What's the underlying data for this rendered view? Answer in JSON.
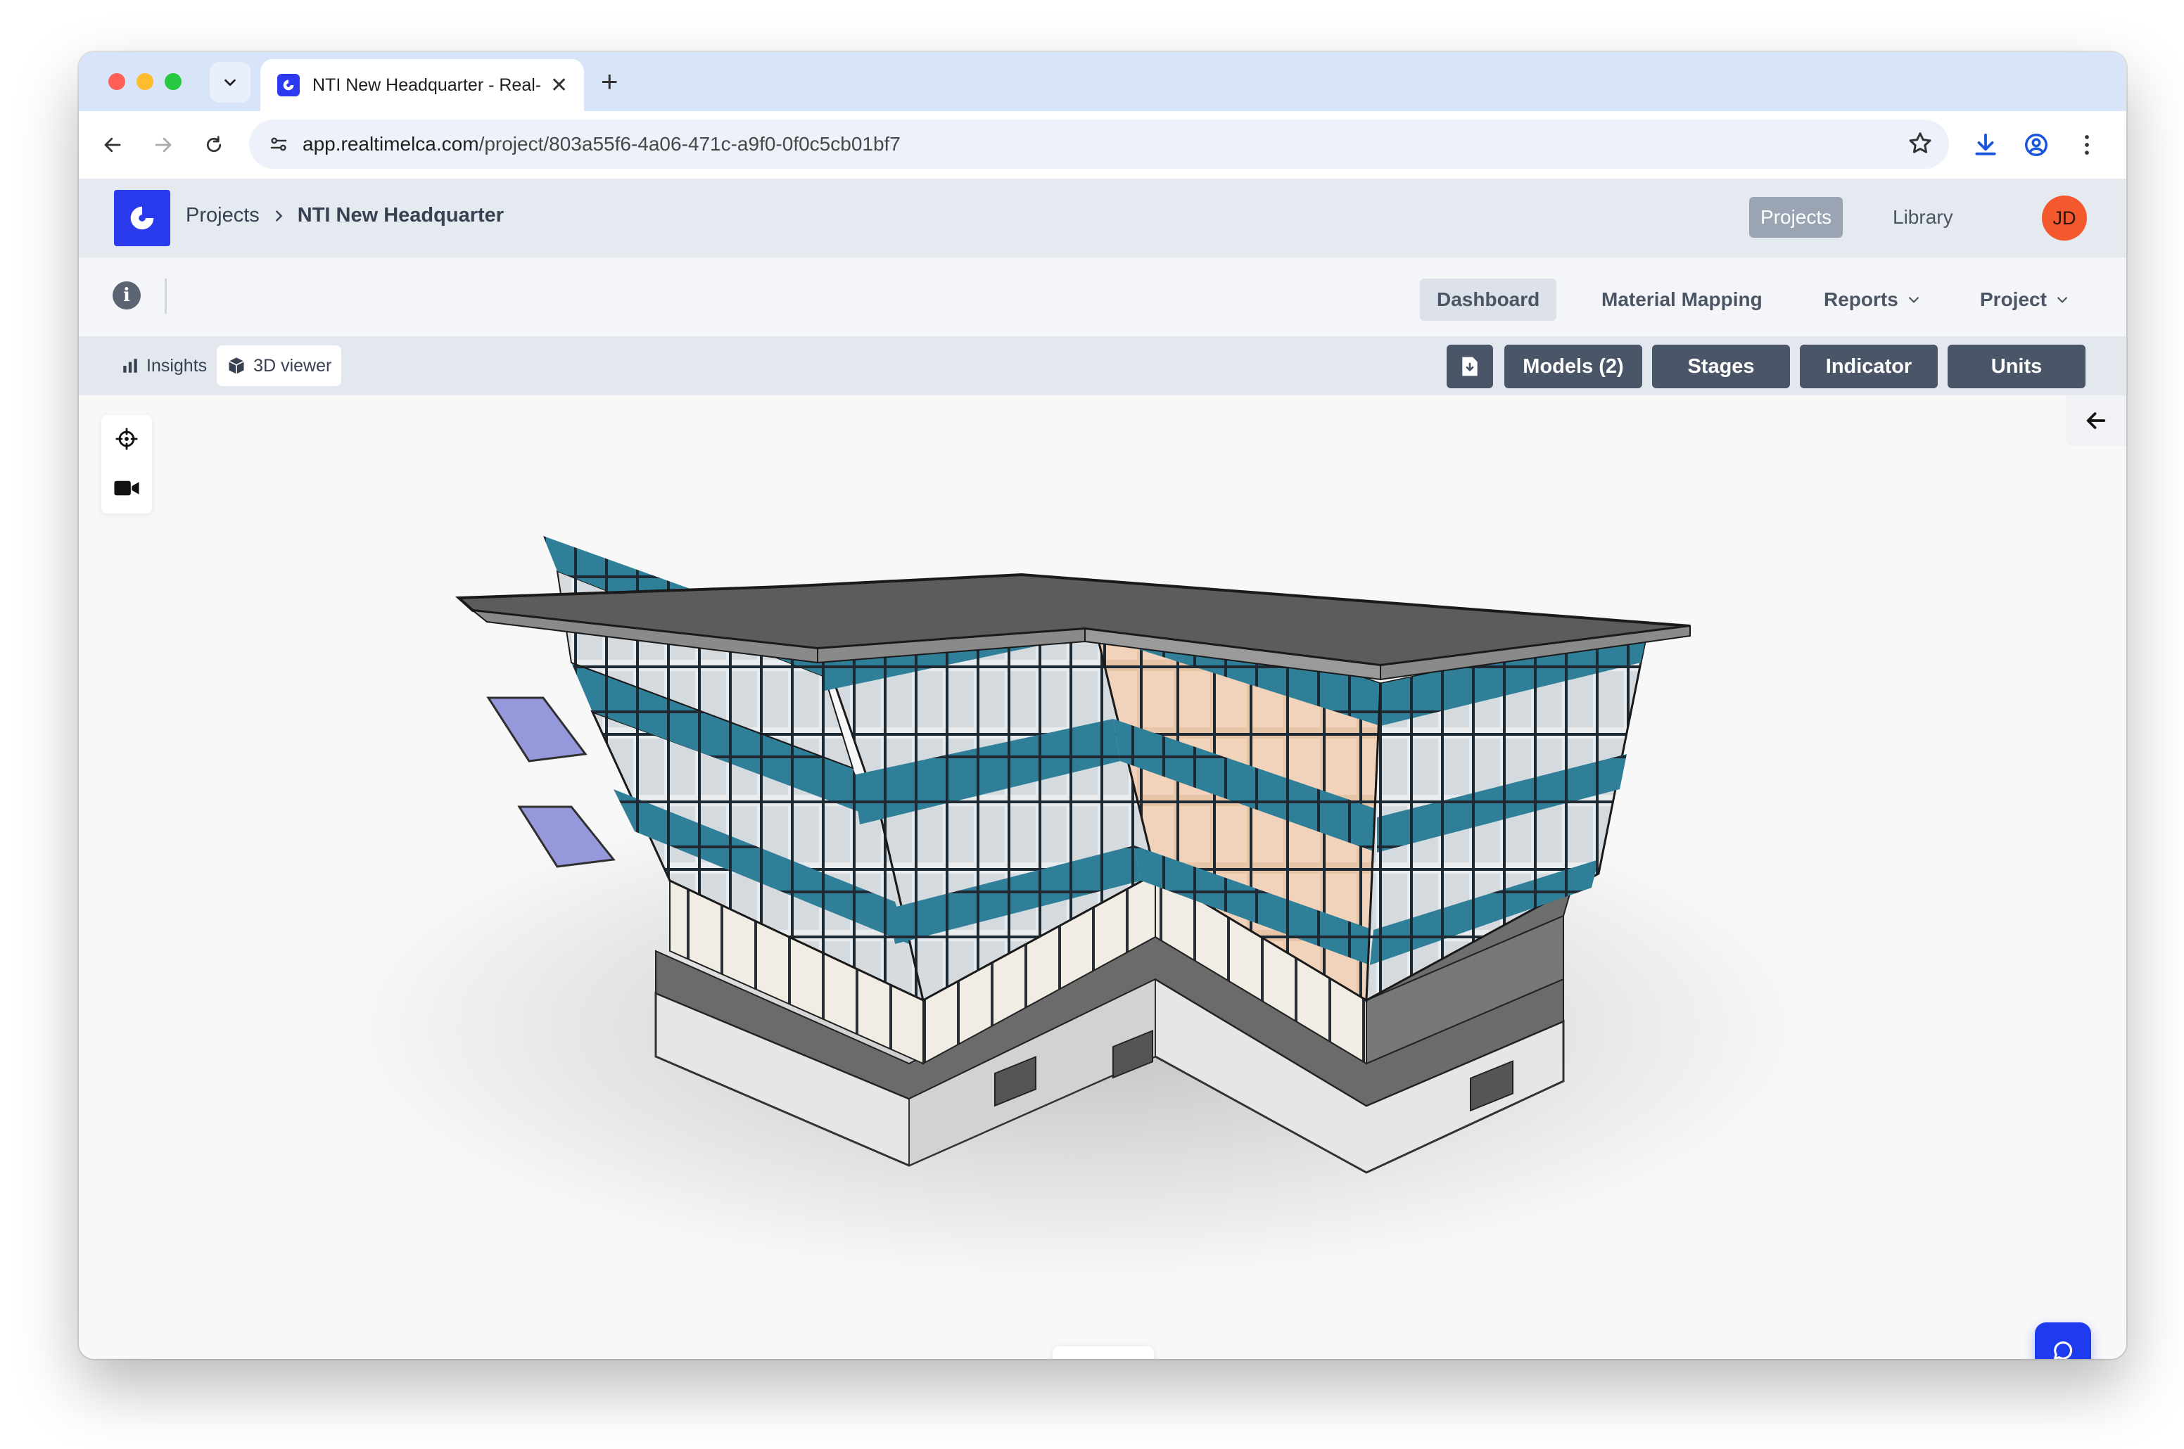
{
  "browser": {
    "tab_title": "NTI New Headquarter - Real-",
    "url_host": "app.realtimelca.com",
    "url_path": "/project/803a55f6-4a06-471c-a9f0-0f0c5cb01bf7"
  },
  "header": {
    "breadcrumb_root": "Projects",
    "breadcrumb_current": "NTI New Headquarter",
    "nav_projects": "Projects",
    "nav_library": "Library",
    "avatar_initials": "JD"
  },
  "subnav": {
    "dashboard": "Dashboard",
    "material_mapping": "Material Mapping",
    "reports": "Reports",
    "project": "Project"
  },
  "viewbar": {
    "tab_insights": "Insights",
    "tab_3d_viewer": "3D viewer",
    "models_button": "Models (2)",
    "stages_button": "Stages",
    "indicator_button": "Indicator",
    "units_button": "Units"
  },
  "colors": {
    "brand": "#2a3aed",
    "avatar": "#f4582d",
    "dark_button": "#4a5568",
    "glass_teal": "#2d7f9a",
    "glass_warm": "#e8c2a4"
  },
  "icons": [
    "chevron-down-icon",
    "close-icon",
    "plus-icon",
    "back-arrow-icon",
    "forward-arrow-icon",
    "reload-icon",
    "site-settings-icon",
    "star-icon",
    "download-icon",
    "account-icon",
    "more-vert-icon",
    "info-icon",
    "bar-chart-icon",
    "cube-icon",
    "file-download-icon",
    "crosshair-icon",
    "video-camera-icon",
    "arrow-left-icon",
    "scissors-icon",
    "glasses-icon",
    "chat-icon"
  ]
}
